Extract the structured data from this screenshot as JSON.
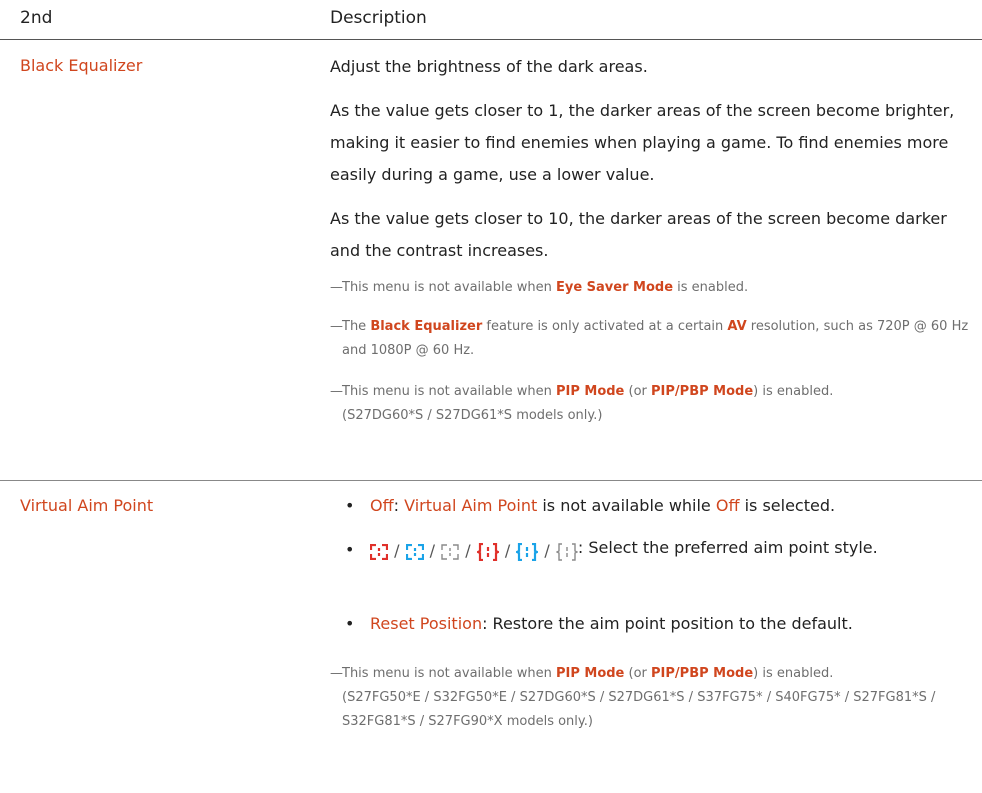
{
  "header": {
    "col1": "2nd",
    "col2": "Description"
  },
  "black_equalizer": {
    "term": "Black Equalizer",
    "p1": "Adjust the brightness of the dark areas.",
    "p2": "As the value gets closer to 1, the darker areas of the screen become brighter, making it easier to find enemies when playing a game. To find enemies more easily during a game, use a lower value.",
    "p3": "As the value gets closer to 10, the darker areas of the screen become darker and the contrast increases.",
    "note1": {
      "a": "This menu is not available when ",
      "b": "Eye Saver Mode",
      "c": " is enabled."
    },
    "note2": {
      "a": "The ",
      "b": "Black Equalizer",
      "c": " feature is only activated at a certain ",
      "d": "AV",
      "e": " resolution, such as 720P @ 60 Hz and 1080P @ 60 Hz."
    },
    "note3": {
      "a": "This menu is not available when ",
      "b": "PIP Mode",
      "c": " (or ",
      "d": "PIP/PBP Mode",
      "e": ") is enabled.",
      "f": "(S27DG60*S / S27DG61*S models only.)"
    }
  },
  "virtual_aim_point": {
    "term": "Virtual Aim Point",
    "b1": {
      "a": "Off",
      "b": ": ",
      "c": "Virtual Aim Point",
      "d": " is not available while ",
      "e": "Off",
      "f": " is selected."
    },
    "b2": {
      "sep": "/",
      "tail": ": Select the preferred aim point style."
    },
    "b3": {
      "a": "Reset Position",
      "b": ": Restore the aim point position to the default."
    },
    "note": {
      "a": "This menu is not available when ",
      "b": "PIP Mode",
      "c": " (or ",
      "d": "PIP/PBP Mode",
      "e": ") is enabled.",
      "f": "(S27FG50*E / S32FG50*E / S27DG60*S / S27DG61*S / S37FG75* / S40FG75* / S27FG81*S / S32FG81*S / S27FG90*X models only.)"
    }
  },
  "colors": {
    "accent": "#d0461e",
    "blue": "#1aa3e8",
    "gray": "#8a8a8a"
  },
  "icons": {
    "note_marker": "—",
    "bullet": "•"
  }
}
